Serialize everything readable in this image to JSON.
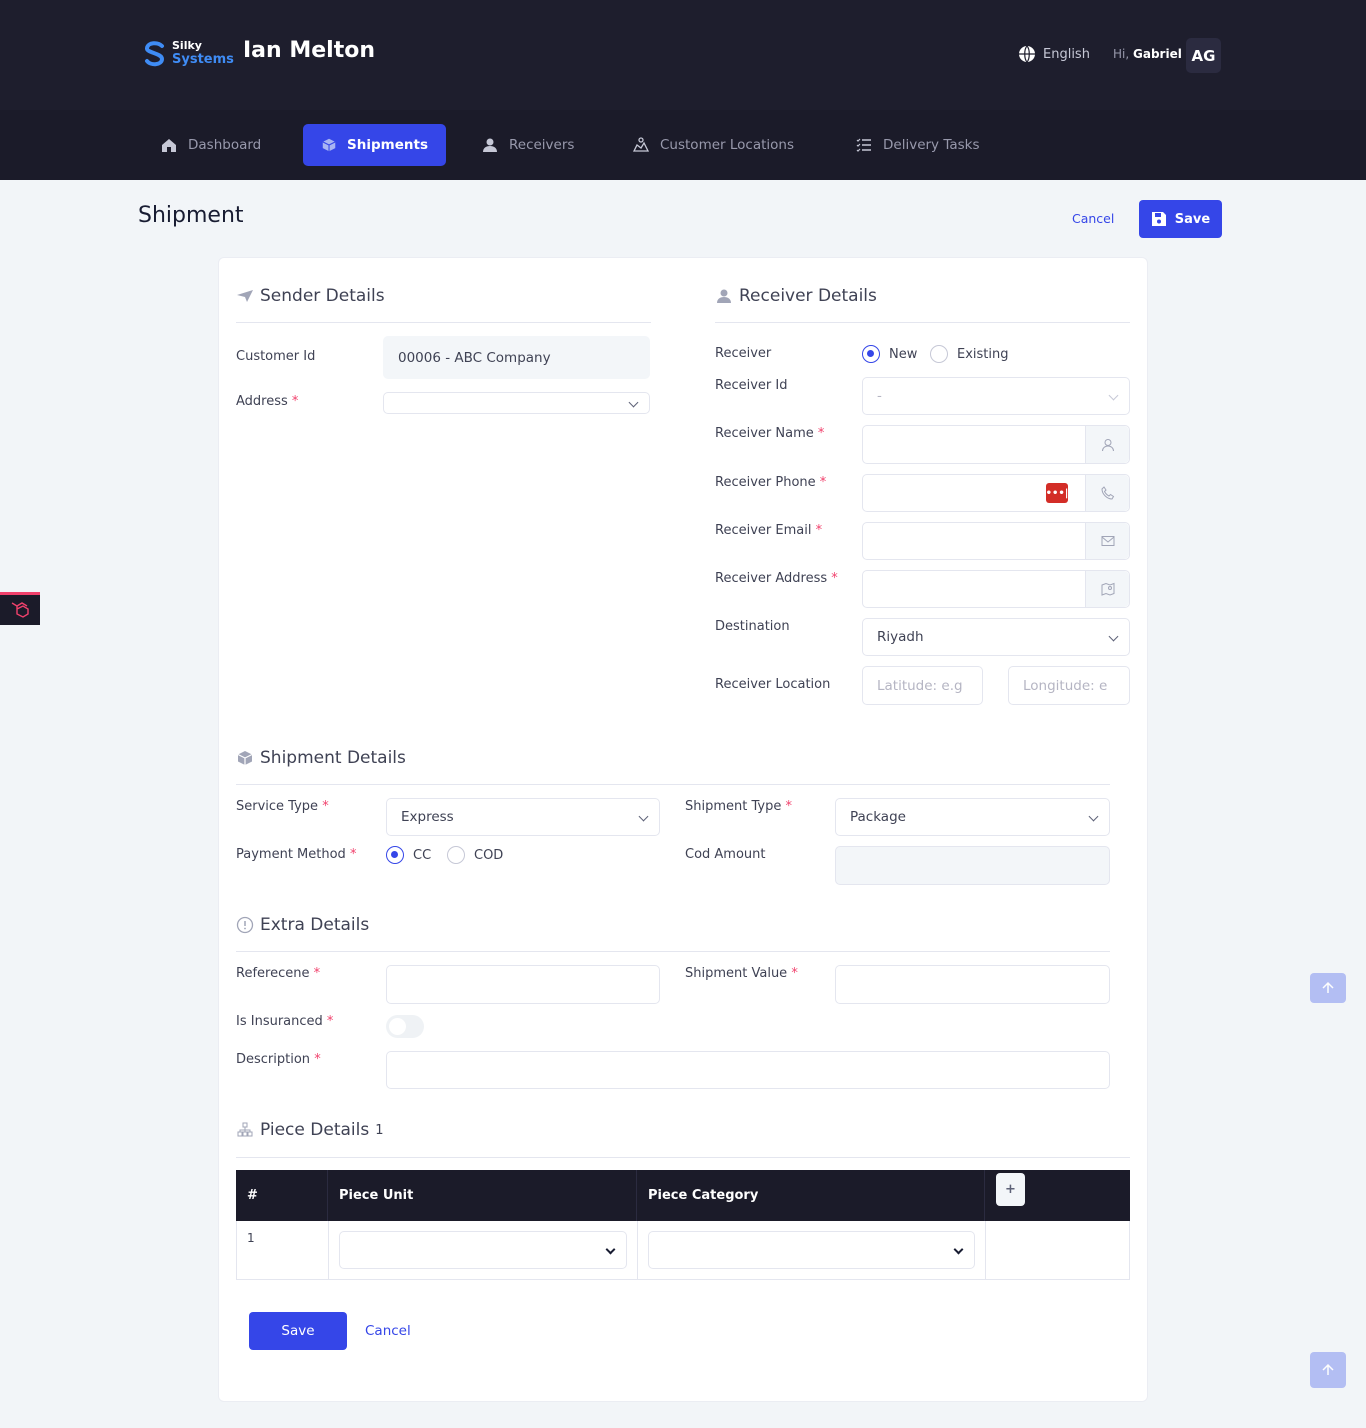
{
  "header": {
    "logo_line1": "Silky",
    "logo_line2": "Systems",
    "app_title": "Ian Melton",
    "language": "English",
    "greeting": "Hi,",
    "user_name": "Gabriel",
    "avatar_initials": "AG"
  },
  "nav": {
    "items": [
      {
        "label": "Dashboard",
        "icon": "home-icon"
      },
      {
        "label": "Shipments",
        "icon": "box-icon",
        "active": true
      },
      {
        "label": "Receivers",
        "icon": "user-icon"
      },
      {
        "label": "Customer Locations",
        "icon": "map-icon"
      },
      {
        "label": "Delivery Tasks",
        "icon": "list-check-icon"
      }
    ]
  },
  "page": {
    "title": "Shipment",
    "cancel_label": "Cancel",
    "save_label": "Save"
  },
  "sender": {
    "title": "Sender Details",
    "customer_id_label": "Customer Id",
    "customer_id_value": "00006 - ABC Company",
    "address_label": "Address",
    "required_mark": "*"
  },
  "receiver": {
    "title": "Receiver Details",
    "receiver_label": "Receiver",
    "option_new": "New",
    "option_existing": "Existing",
    "receiver_id_label": "Receiver Id",
    "receiver_id_value": "-",
    "name_label": "Receiver Name",
    "phone_label": "Receiver Phone",
    "email_label": "Receiver Email",
    "address_label": "Receiver Address",
    "destination_label": "Destination",
    "destination_value": "Riyadh",
    "location_label": "Receiver Location",
    "latitude_placeholder": "Latitude: e.g",
    "longitude_placeholder": "Longitude: e"
  },
  "shipment": {
    "title": "Shipment Details",
    "service_type_label": "Service Type",
    "service_type_value": "Express",
    "shipment_type_label": "Shipment Type",
    "shipment_type_value": "Package",
    "payment_method_label": "Payment Method",
    "option_cc": "CC",
    "option_cod": "COD",
    "cod_amount_label": "Cod Amount"
  },
  "extra": {
    "title": "Extra Details",
    "reference_label": "Referecene",
    "shipment_value_label": "Shipment Value",
    "insured_label": "Is Insuranced",
    "description_label": "Description"
  },
  "pieces": {
    "title": "Piece Details",
    "count": "1",
    "columns": [
      "#",
      "Piece Unit",
      "Piece Category"
    ],
    "add_label": "+",
    "rows": [
      {
        "index": "1"
      }
    ]
  },
  "footer": {
    "save_label": "Save",
    "cancel_label": "Cancel"
  },
  "colors": {
    "primary": "#3546e8",
    "dark": "#1e1e2d",
    "required": "#f1416c"
  }
}
